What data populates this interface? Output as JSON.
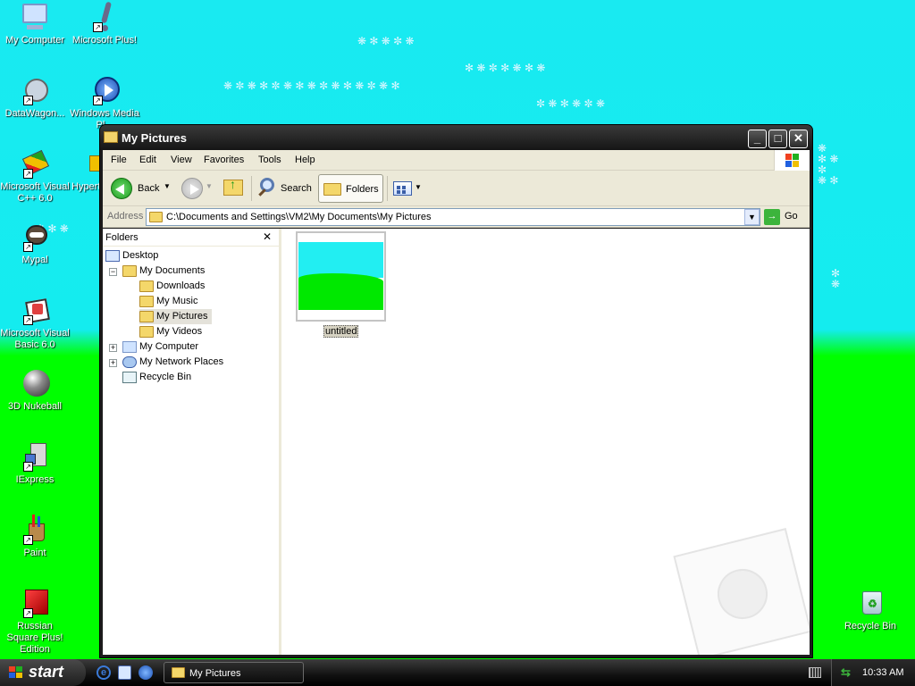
{
  "desktop": {
    "icons": [
      {
        "label": "My Computer",
        "icon": "computer-icon"
      },
      {
        "label": "Microsoft Plus!",
        "icon": "plus-icon"
      },
      {
        "label": "DataWagon...",
        "icon": "datawagon-icon"
      },
      {
        "label": "Windows Media Pl...",
        "icon": "media-player-icon"
      },
      {
        "label": "Microsoft Visual C++ 6.0",
        "icon": "visual-cpp-icon"
      },
      {
        "label": "Hypert...",
        "icon": "hyperterminal-icon"
      },
      {
        "label": "Mypal",
        "icon": "mypal-icon"
      },
      {
        "label": "Microsoft Visual Basic 6.0",
        "icon": "visual-basic-icon"
      },
      {
        "label": "3D Nukeball",
        "icon": "nukeball-icon"
      },
      {
        "label": "IExpress",
        "icon": "iexpress-icon"
      },
      {
        "label": "Paint",
        "icon": "paint-icon"
      },
      {
        "label": "Russian Square Plus! Edition",
        "icon": "russian-square-icon"
      },
      {
        "label": "Recycle Bin",
        "icon": "recycle-bin-icon"
      }
    ]
  },
  "window": {
    "title": "My Pictures",
    "menu": [
      "File",
      "Edit",
      "View",
      "Favorites",
      "Tools",
      "Help"
    ],
    "toolbar": {
      "back": "Back",
      "search": "Search",
      "folders": "Folders"
    },
    "address": {
      "label": "Address",
      "value": "C:\\Documents and Settings\\VM2\\My Documents\\My Pictures",
      "go": "Go"
    },
    "folders_pane": {
      "title": "Folders",
      "close": "✕",
      "tree": [
        {
          "label": "Desktop"
        },
        {
          "label": "My Documents"
        },
        {
          "label": "Downloads"
        },
        {
          "label": "My Music"
        },
        {
          "label": "My Pictures"
        },
        {
          "label": "My Videos"
        },
        {
          "label": "My Computer"
        },
        {
          "label": "My Network Places"
        },
        {
          "label": "Recycle Bin"
        }
      ]
    },
    "files": [
      {
        "name": "untitled"
      }
    ]
  },
  "taskbar": {
    "start": "start",
    "task": "My Pictures",
    "clock": "10:33 AM"
  },
  "colors": {
    "sky": "#19eaf1",
    "grass": "#00ff00",
    "titlebar": "#1c1c1c",
    "chrome": "#ece9d8"
  }
}
